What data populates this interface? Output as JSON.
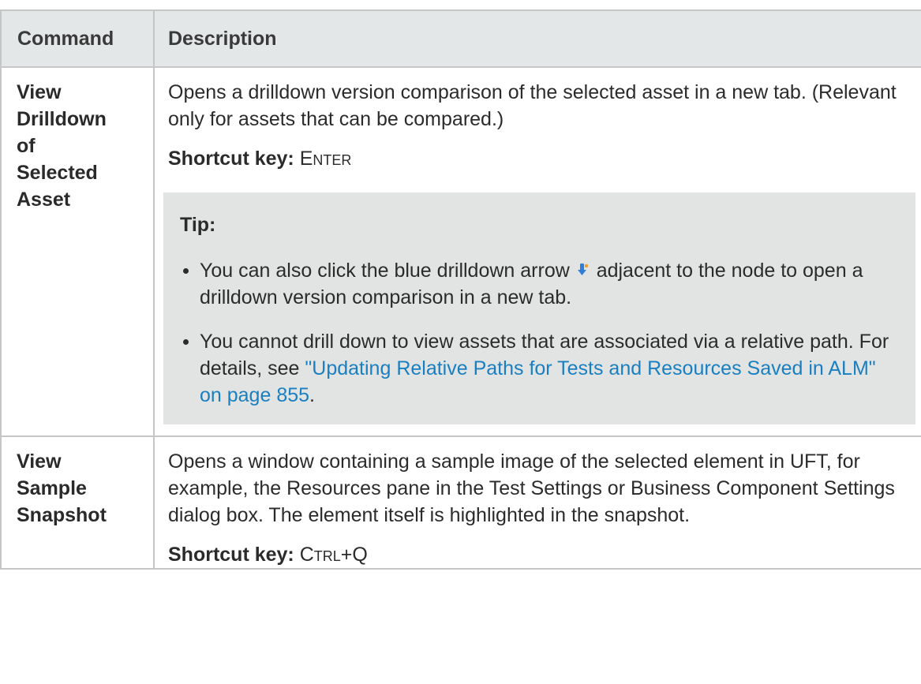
{
  "table": {
    "headers": {
      "command": "Command",
      "description": "Description"
    },
    "rows": [
      {
        "command_lines": [
          "View",
          "Drilldown",
          "of",
          "Selected",
          "Asset"
        ],
        "description": "Opens a drilldown version comparison of the selected asset in a new tab. (Relevant only for assets that can be compared.)",
        "shortcut_label": "Shortcut key:",
        "shortcut_key": "Enter",
        "tip": {
          "title": "Tip:",
          "items": [
            {
              "before_icon": "You can also click the blue drilldown arrow",
              "icon": "drilldown-arrow-icon",
              "after_icon": "adjacent to the node to open a drilldown version comparison in a new tab."
            },
            {
              "text": "You cannot drill down to view assets that are associated via a relative path. For details, see",
              "link_text": "\"Updating Relative Paths for Tests and Resources Saved in ALM\" on page 855",
              "end": "."
            }
          ]
        }
      },
      {
        "command_lines": [
          "View",
          "Sample",
          "Snapshot"
        ],
        "description": "Opens a window containing a sample image of the selected element in UFT, for example, the Resources pane in the Test Settings or Business Component Settings dialog box. The element itself is highlighted in the snapshot.",
        "shortcut_label": "Shortcut key:",
        "shortcut_key": "Ctrl+Q"
      }
    ]
  },
  "colors": {
    "header_bg": "#e4e7e8",
    "border": "#c6c6c6",
    "tip_bg": "#e2e4e4",
    "link": "#1a7fc0",
    "icon_blue": "#2f7fd8",
    "icon_orange": "#f0a030"
  }
}
